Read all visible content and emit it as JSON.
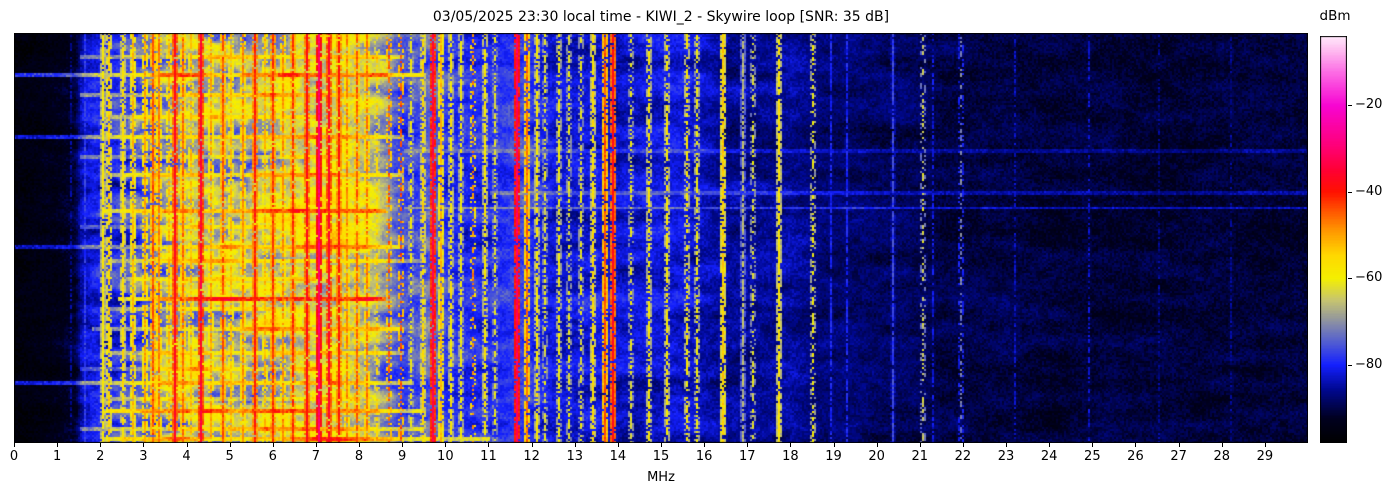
{
  "window": {
    "kind": "spectrogram-figure",
    "background": "#ffffff"
  },
  "chart_data": {
    "type": "heatmap",
    "subtype": "radio-spectrogram-waterfall",
    "title": "03/05/2025 23:30 local time - KIWI_2 - Skywire loop [SNR: 35 dB]",
    "xlabel": "MHz",
    "x_range": [
      0,
      30
    ],
    "x_ticks": [
      0,
      1,
      2,
      3,
      4,
      5,
      6,
      7,
      8,
      9,
      10,
      11,
      12,
      13,
      14,
      15,
      16,
      17,
      18,
      19,
      20,
      21,
      22,
      23,
      24,
      25,
      26,
      27,
      28,
      29
    ],
    "y_axis": {
      "label": "",
      "ticks": [],
      "meaning": "time (unlabeled)"
    },
    "grid": false,
    "legend": "none",
    "colorbar": {
      "label": "dBm",
      "vmin": -98,
      "vmax": -4,
      "ticks": [
        {
          "value": -20,
          "label": "−20"
        },
        {
          "value": -40,
          "label": "−40"
        },
        {
          "value": -60,
          "label": "−60"
        },
        {
          "value": -80,
          "label": "−80"
        }
      ]
    },
    "colormap_stops": [
      [
        0.0,
        "#000000"
      ],
      [
        0.06,
        "#000020"
      ],
      [
        0.13,
        "#000890"
      ],
      [
        0.191,
        "#1420ff"
      ],
      [
        0.25,
        "#5560cf"
      ],
      [
        0.3,
        "#8f93a0"
      ],
      [
        0.35,
        "#c6c470"
      ],
      [
        0.404,
        "#f4f000"
      ],
      [
        0.46,
        "#ffd800"
      ],
      [
        0.52,
        "#ff9900"
      ],
      [
        0.57,
        "#ff5500"
      ],
      [
        0.617,
        "#ff1100"
      ],
      [
        0.67,
        "#ff0033"
      ],
      [
        0.73,
        "#ff0077"
      ],
      [
        0.83,
        "#f705d2"
      ],
      [
        0.91,
        "#fc6ae4"
      ],
      [
        0.97,
        "#fec2f1"
      ],
      [
        1.0,
        "#ffe9fb"
      ]
    ],
    "noise_floor_dbm": [
      [
        0,
        -96
      ],
      [
        0.5,
        -95
      ],
      [
        1.0,
        -94
      ],
      [
        1.4,
        -92
      ],
      [
        1.55,
        -84
      ],
      [
        1.8,
        -82
      ],
      [
        2.1,
        -81
      ],
      [
        2.5,
        -79
      ],
      [
        3.0,
        -75
      ],
      [
        3.4,
        -70
      ],
      [
        3.8,
        -67
      ],
      [
        4.2,
        -66
      ],
      [
        4.6,
        -67
      ],
      [
        5.0,
        -68
      ],
      [
        5.4,
        -67
      ],
      [
        5.8,
        -65
      ],
      [
        6.2,
        -64
      ],
      [
        6.6,
        -62
      ],
      [
        7.0,
        -61
      ],
      [
        7.4,
        -61
      ],
      [
        7.8,
        -63
      ],
      [
        8.2,
        -65
      ],
      [
        8.6,
        -70
      ],
      [
        9.0,
        -77
      ],
      [
        9.4,
        -75
      ],
      [
        9.7,
        -72
      ],
      [
        10.0,
        -78
      ],
      [
        10.5,
        -80
      ],
      [
        11.0,
        -80
      ],
      [
        11.5,
        -78
      ],
      [
        11.8,
        -77
      ],
      [
        12.2,
        -81
      ],
      [
        12.6,
        -82
      ],
      [
        13.0,
        -82
      ],
      [
        13.5,
        -81
      ],
      [
        14.0,
        -83
      ],
      [
        14.5,
        -83
      ],
      [
        15.0,
        -82
      ],
      [
        15.5,
        -82
      ],
      [
        16.0,
        -84
      ],
      [
        16.6,
        -86
      ],
      [
        17.4,
        -86
      ],
      [
        18.0,
        -85
      ],
      [
        18.5,
        -87
      ],
      [
        19.0,
        -88
      ],
      [
        19.5,
        -88
      ],
      [
        20.0,
        -89
      ],
      [
        21.0,
        -89
      ],
      [
        21.5,
        -90
      ],
      [
        22.0,
        -90
      ],
      [
        23.0,
        -90
      ],
      [
        24.0,
        -91
      ],
      [
        25.0,
        -91
      ],
      [
        26.0,
        -91
      ],
      [
        27.0,
        -91
      ],
      [
        28.0,
        -91
      ],
      [
        29.0,
        -91
      ],
      [
        30.0,
        -91
      ]
    ],
    "variance_dbm": [
      [
        0,
        1.5
      ],
      [
        1.3,
        2
      ],
      [
        1.5,
        4
      ],
      [
        2,
        6
      ],
      [
        2.5,
        8
      ],
      [
        3,
        10
      ],
      [
        3.5,
        11
      ],
      [
        4,
        11
      ],
      [
        5,
        11
      ],
      [
        6,
        10
      ],
      [
        7,
        9
      ],
      [
        8,
        9
      ],
      [
        8.7,
        7
      ],
      [
        9,
        5
      ],
      [
        10,
        5
      ],
      [
        11,
        5
      ],
      [
        12,
        4
      ],
      [
        13,
        4
      ],
      [
        14,
        4
      ],
      [
        15,
        4
      ],
      [
        16,
        3.5
      ],
      [
        17,
        3.5
      ],
      [
        18,
        3
      ],
      [
        19,
        2.5
      ],
      [
        20,
        2.5
      ],
      [
        22,
        2.2
      ],
      [
        25,
        2
      ],
      [
        30,
        2
      ]
    ],
    "carriers_format": [
      "mhz",
      "peak_dbm",
      "width_cells",
      "persistence"
    ],
    "carriers": [
      [
        1.3,
        -86,
        1,
        0.6
      ],
      [
        1.62,
        -78,
        2,
        0.9
      ],
      [
        2.05,
        -58,
        1,
        0.95
      ],
      [
        2.2,
        -54,
        1,
        0.75
      ],
      [
        2.5,
        -56,
        1,
        0.8
      ],
      [
        2.75,
        -52,
        1,
        0.85
      ],
      [
        3.0,
        -50,
        1,
        0.8
      ],
      [
        3.2,
        -44,
        1,
        0.9
      ],
      [
        3.33,
        -47,
        1,
        0.85
      ],
      [
        3.55,
        -52,
        1,
        0.7
      ],
      [
        3.7,
        -37,
        2,
        0.97
      ],
      [
        3.9,
        -46,
        1,
        0.85
      ],
      [
        4.1,
        -52,
        1,
        0.7
      ],
      [
        4.3,
        -35,
        2,
        0.97
      ],
      [
        4.55,
        -50,
        1,
        0.75
      ],
      [
        4.8,
        -44,
        1,
        0.9
      ],
      [
        5.0,
        -52,
        1,
        0.8
      ],
      [
        5.3,
        -48,
        1,
        0.8
      ],
      [
        5.55,
        -40,
        1,
        0.92
      ],
      [
        5.8,
        -52,
        1,
        0.7
      ],
      [
        6.0,
        -42,
        1,
        0.9
      ],
      [
        6.2,
        -48,
        1,
        0.8
      ],
      [
        6.45,
        -42,
        1,
        0.85
      ],
      [
        6.75,
        -38,
        2,
        0.95
      ],
      [
        7.05,
        -30,
        2,
        0.98
      ],
      [
        7.3,
        -36,
        1,
        0.9
      ],
      [
        7.5,
        -40,
        1,
        0.9
      ],
      [
        7.7,
        -48,
        1,
        0.8
      ],
      [
        7.95,
        -45,
        1,
        0.8
      ],
      [
        8.15,
        -47,
        1,
        0.75
      ],
      [
        8.4,
        -55,
        1,
        0.6
      ],
      [
        8.65,
        -45,
        1,
        0.45
      ],
      [
        8.95,
        -44,
        1,
        0.4
      ],
      [
        9.2,
        -60,
        1,
        0.6
      ],
      [
        9.45,
        -55,
        1,
        0.7
      ],
      [
        9.67,
        -33,
        2,
        0.97
      ],
      [
        9.87,
        -52,
        2,
        0.9
      ],
      [
        10.1,
        -58,
        1,
        0.75
      ],
      [
        10.35,
        -60,
        1,
        0.7
      ],
      [
        10.6,
        -48,
        1,
        0.35
      ],
      [
        10.9,
        -58,
        1,
        0.7
      ],
      [
        11.15,
        -62,
        1,
        0.6
      ],
      [
        11.65,
        -31,
        2,
        0.97
      ],
      [
        11.87,
        -46,
        1,
        0.85
      ],
      [
        12.1,
        -58,
        1,
        0.8
      ],
      [
        12.3,
        -62,
        1,
        0.6
      ],
      [
        12.6,
        -60,
        1,
        0.7
      ],
      [
        12.85,
        -62,
        1,
        0.6
      ],
      [
        13.1,
        -62,
        1,
        0.55
      ],
      [
        13.4,
        -56,
        1,
        0.8
      ],
      [
        13.7,
        -44,
        1,
        0.9
      ],
      [
        13.87,
        -37,
        2,
        0.95
      ],
      [
        14.3,
        -62,
        1,
        0.5
      ],
      [
        14.7,
        -58,
        1,
        0.7
      ],
      [
        15.1,
        -58,
        1,
        0.7
      ],
      [
        15.6,
        -58,
        1,
        0.55
      ],
      [
        15.8,
        -60,
        1,
        0.6
      ],
      [
        16.4,
        -54,
        1,
        0.9
      ],
      [
        16.9,
        -66,
        1,
        0.8
      ],
      [
        17.1,
        -62,
        1,
        0.5
      ],
      [
        17.7,
        -57,
        1,
        0.85
      ],
      [
        18.5,
        -60,
        1,
        0.5
      ],
      [
        18.9,
        -80,
        1,
        0.8
      ],
      [
        19.3,
        -80,
        1,
        0.7
      ],
      [
        20.35,
        -77,
        1,
        0.85
      ],
      [
        21.05,
        -64,
        1,
        0.4
      ],
      [
        21.3,
        -82,
        1,
        0.6
      ],
      [
        21.95,
        -72,
        1,
        0.45
      ],
      [
        23.2,
        -84,
        1,
        0.6
      ],
      [
        24.9,
        -83,
        1,
        0.5
      ],
      [
        26.5,
        -86,
        1,
        0.5
      ],
      [
        28.2,
        -86,
        1,
        0.5
      ]
    ],
    "bursts_format": [
      "t_fraction",
      "mhz_from",
      "mhz_to",
      "boost_db"
    ],
    "bursts": [
      [
        0.055,
        1.5,
        9.0,
        10
      ],
      [
        0.1,
        0.0,
        9.5,
        16
      ],
      [
        0.145,
        1.5,
        8.0,
        12
      ],
      [
        0.2,
        2.0,
        7.0,
        8
      ],
      [
        0.25,
        0.0,
        9.0,
        13
      ],
      [
        0.285,
        9.0,
        30,
        5
      ],
      [
        0.3,
        1.5,
        7.5,
        9
      ],
      [
        0.345,
        2.0,
        9.0,
        12
      ],
      [
        0.385,
        11.0,
        30,
        6
      ],
      [
        0.425,
        9.0,
        30,
        8
      ],
      [
        0.43,
        2.0,
        8.6,
        15
      ],
      [
        0.47,
        1.5,
        6.0,
        8
      ],
      [
        0.52,
        0.0,
        9.0,
        11
      ],
      [
        0.555,
        2.0,
        9.5,
        9
      ],
      [
        0.6,
        2.5,
        7.0,
        8
      ],
      [
        0.645,
        2.4,
        8.6,
        22
      ],
      [
        0.67,
        2.0,
        6.0,
        10
      ],
      [
        0.72,
        1.8,
        9.0,
        11
      ],
      [
        0.78,
        2.0,
        9.0,
        9
      ],
      [
        0.82,
        1.5,
        7.0,
        8
      ],
      [
        0.855,
        0.0,
        9.2,
        13
      ],
      [
        0.89,
        2.0,
        8.0,
        8
      ],
      [
        0.92,
        2.0,
        9.5,
        15
      ],
      [
        0.965,
        1.5,
        9.5,
        12
      ],
      [
        0.99,
        2.0,
        11.0,
        14
      ]
    ],
    "seed": 1337
  }
}
